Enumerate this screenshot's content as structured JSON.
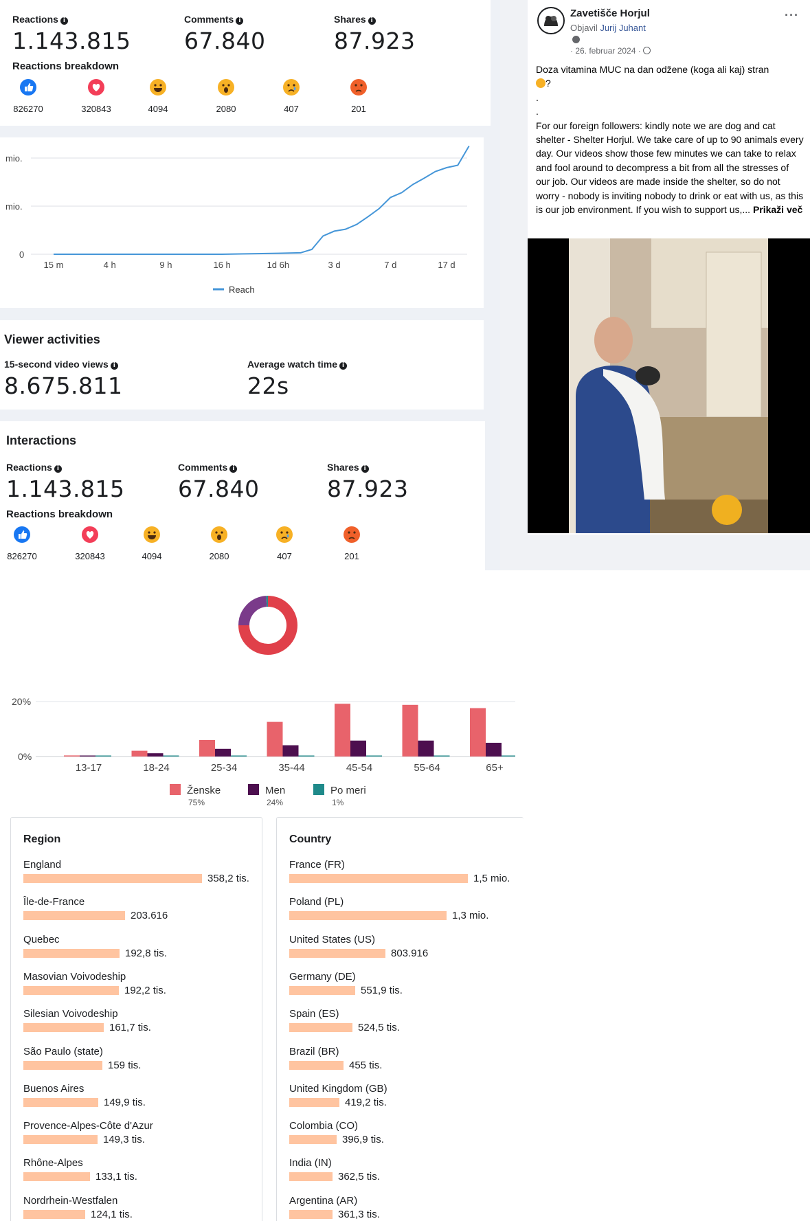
{
  "top_stats": {
    "reactions_label": "Reactions",
    "reactions_value": "1.143.815",
    "comments_label": "Comments",
    "comments_value": "67.840",
    "shares_label": "Shares",
    "shares_value": "87.923",
    "breakdown_title": "Reactions breakdown",
    "reactions": [
      {
        "icon": "like-icon",
        "count": "826270",
        "color": "#1877f2"
      },
      {
        "icon": "love-icon",
        "count": "320843",
        "color": "#f33e58"
      },
      {
        "icon": "haha-icon",
        "count": "4094",
        "color": "#f7b125"
      },
      {
        "icon": "wow-icon",
        "count": "2080",
        "color": "#f7b125"
      },
      {
        "icon": "sad-icon",
        "count": "407",
        "color": "#f7b125"
      },
      {
        "icon": "angry-icon",
        "count": "201",
        "color": "#e9710f"
      }
    ]
  },
  "reach_chart": {
    "chart_data": {
      "type": "line",
      "title": "",
      "xlabel": "",
      "ylabel": "",
      "y_tick_labels": [
        "mio.",
        "mio.",
        "0"
      ],
      "x_tick_labels": [
        "15 m",
        "4 h",
        "9 h",
        "16 h",
        "1d 6h",
        "3 d",
        "7 d",
        "17 d"
      ],
      "series": [
        {
          "name": "Reach",
          "color": "#4596d8",
          "x_index": [
            0,
            1,
            2,
            3,
            4,
            4.4,
            4.6,
            4.8,
            5.0,
            5.2,
            5.4,
            5.6,
            5.8,
            6.0,
            6.2,
            6.4,
            6.6,
            6.8,
            7.0,
            7.2,
            7.4
          ],
          "values": [
            0,
            0,
            0,
            0,
            0.02,
            0.03,
            0.1,
            0.38,
            0.48,
            0.52,
            0.62,
            0.78,
            0.95,
            1.18,
            1.28,
            1.45,
            1.58,
            1.72,
            1.8,
            1.85,
            2.25
          ]
        }
      ]
    },
    "legend_label": "Reach"
  },
  "viewer_activities": {
    "title": "Viewer activities",
    "views_label": "15-second video views",
    "views_value": "8.675.811",
    "watch_label": "Average watch time",
    "watch_value": "22s"
  },
  "interactions": {
    "title": "Interactions",
    "reactions_label": "Reactions",
    "reactions_value": "1.143.815",
    "comments_label": "Comments",
    "comments_value": "67.840",
    "shares_label": "Shares",
    "shares_value": "87.923",
    "breakdown_title": "Reactions breakdown",
    "reactions": [
      {
        "icon": "like-icon",
        "count": "826270"
      },
      {
        "icon": "love-icon",
        "count": "320843"
      },
      {
        "icon": "haha-icon",
        "count": "4094"
      },
      {
        "icon": "wow-icon",
        "count": "2080"
      },
      {
        "icon": "sad-icon",
        "count": "407"
      },
      {
        "icon": "angry-icon",
        "count": "201"
      }
    ]
  },
  "post": {
    "page_name": "Zavetišče Horjul",
    "posted_by_prefix": "Objavil",
    "posted_by_name": "Jurij Juhant",
    "date": "· 26. februar 2024 ·",
    "more_icon": "more-options-icon",
    "text_line1": "Doza vitamina MUC na dan odžene (koga ali kaj) stran",
    "text_line2": "?",
    "dot1": ".",
    "dot2": ".",
    "body": "For our foreign followers: kindly note we are dog and cat shelter - Shelter Horjul. We take care of up to 90 animals every day. Our videos show those few minutes we can take to relax and fool around to decompress a bit from all the stresses of our job. Our videos are made inside the shelter, so do not worry - nobody is inviting nobody to drink or eat with us, as this is our job environment. If you wish to support us,...",
    "see_more": "Prikaži več"
  },
  "gender_donut": {
    "chart_data": {
      "type": "pie",
      "labels": [
        "Ženske",
        "Men",
        "Po meri"
      ],
      "values": [
        75,
        24,
        1
      ],
      "colors": [
        "#e0404a",
        "#7a3b8a",
        "#2a8a8a"
      ]
    }
  },
  "age_chart": {
    "chart_data": {
      "type": "bar",
      "categories": [
        "13-17",
        "18-24",
        "25-34",
        "35-44",
        "45-54",
        "55-64",
        "65+"
      ],
      "y_tick_labels": [
        "20%",
        "0%"
      ],
      "ylim": [
        0,
        20
      ],
      "series": [
        {
          "name": "Ženske",
          "color": "#e8636b",
          "values": [
            0.4,
            2.1,
            6.0,
            12.6,
            19.2,
            18.8,
            17.6
          ]
        },
        {
          "name": "Men",
          "color": "#4d0f4f",
          "values": [
            0.3,
            1.2,
            2.8,
            4.1,
            5.8,
            5.8,
            5.0
          ]
        },
        {
          "name": "Po meri",
          "color": "#1f8a8a",
          "values": [
            0.2,
            0.2,
            0.3,
            0.3,
            0.3,
            0.3,
            0.3
          ]
        }
      ]
    },
    "legend": [
      {
        "label": "Ženske",
        "pct": "75%",
        "color": "#e8636b"
      },
      {
        "label": "Men",
        "pct": "24%",
        "color": "#4d0f4f"
      },
      {
        "label": "Po meri",
        "pct": "1%",
        "color": "#1f8a8a"
      }
    ]
  },
  "region": {
    "title": "Region",
    "items": [
      {
        "name": "England",
        "value": "358,2 tis.",
        "fraction": 1.0
      },
      {
        "name": "Île-de-France",
        "value": "203.616",
        "fraction": 0.568
      },
      {
        "name": "Quebec",
        "value": "192,8 tis.",
        "fraction": 0.538
      },
      {
        "name": "Masovian Voivodeship",
        "value": "192,2 tis.",
        "fraction": 0.536
      },
      {
        "name": "Silesian Voivodeship",
        "value": "161,7 tis.",
        "fraction": 0.451
      },
      {
        "name": "São Paulo (state)",
        "value": "159 tis.",
        "fraction": 0.444
      },
      {
        "name": "Buenos Aires",
        "value": "149,9 tis.",
        "fraction": 0.418
      },
      {
        "name": "Provence-Alpes-Côte d'Azur",
        "value": "149,3 tis.",
        "fraction": 0.417
      },
      {
        "name": "Rhône-Alpes",
        "value": "133,1 tis.",
        "fraction": 0.372
      },
      {
        "name": "Nordrhein-Westfalen",
        "value": "124,1 tis.",
        "fraction": 0.346
      }
    ]
  },
  "country": {
    "title": "Country",
    "items": [
      {
        "name": "France (FR)",
        "value": "1,5 mio.",
        "fraction": 1.0
      },
      {
        "name": "Poland (PL)",
        "value": "1,3 mio.",
        "fraction": 0.88
      },
      {
        "name": "United States (US)",
        "value": "803.916",
        "fraction": 0.54
      },
      {
        "name": "Germany (DE)",
        "value": "551,9 tis.",
        "fraction": 0.37
      },
      {
        "name": "Spain (ES)",
        "value": "524,5 tis.",
        "fraction": 0.352
      },
      {
        "name": "Brazil (BR)",
        "value": "455 tis.",
        "fraction": 0.305
      },
      {
        "name": "United Kingdom (GB)",
        "value": "419,2 tis.",
        "fraction": 0.281
      },
      {
        "name": "Colombia (CO)",
        "value": "396,9 tis.",
        "fraction": 0.266
      },
      {
        "name": "India (IN)",
        "value": "362,5 tis.",
        "fraction": 0.243
      },
      {
        "name": "Argentina (AR)",
        "value": "361,3 tis.",
        "fraction": 0.242
      }
    ]
  }
}
